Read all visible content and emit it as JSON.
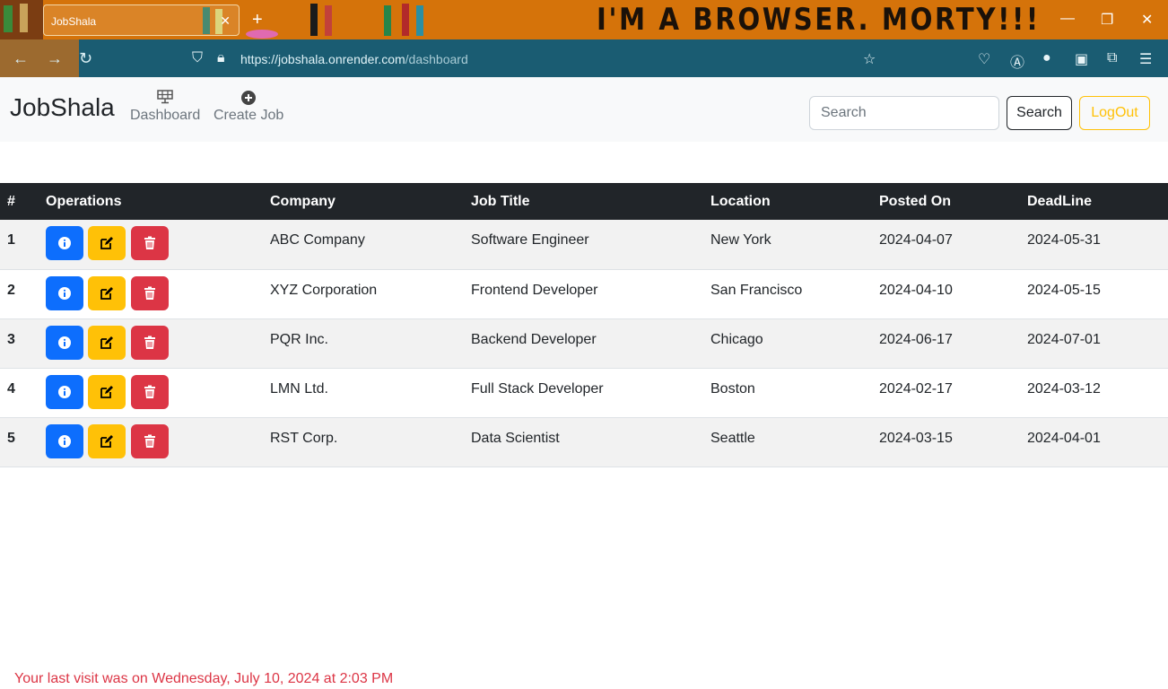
{
  "browser": {
    "tab_title": "JobShala",
    "theme_banner": "I'M A BROWSER. MORTY!!!",
    "url_host": "https://jobshala.onrender.com",
    "url_path": "/dashboard"
  },
  "navbar": {
    "brand": "JobShala",
    "links": [
      {
        "label": "Dashboard",
        "icon": "dashboard-grid-icon"
      },
      {
        "label": "Create Job",
        "icon": "plus-circle-icon"
      }
    ],
    "search_placeholder": "Search",
    "search_label": "Search",
    "logout_label": "LogOut"
  },
  "table": {
    "headers": [
      "#",
      "Operations",
      "Company",
      "Job Title",
      "Location",
      "Posted On",
      "DeadLine"
    ],
    "rows": [
      {
        "idx": "1",
        "company": "ABC Company",
        "title": "Software Engineer",
        "location": "New York",
        "posted": "2024-04-07",
        "deadline": "2024-05-31"
      },
      {
        "idx": "2",
        "company": "XYZ Corporation",
        "title": "Frontend Developer",
        "location": "San Francisco",
        "posted": "2024-04-10",
        "deadline": "2024-05-15"
      },
      {
        "idx": "3",
        "company": "PQR Inc.",
        "title": "Backend Developer",
        "location": "Chicago",
        "posted": "2024-06-17",
        "deadline": "2024-07-01"
      },
      {
        "idx": "4",
        "company": "LMN Ltd.",
        "title": "Full Stack Developer",
        "location": "Boston",
        "posted": "2024-02-17",
        "deadline": "2024-03-12"
      },
      {
        "idx": "5",
        "company": "RST Corp.",
        "title": "Data Scientist",
        "location": "Seattle",
        "posted": "2024-03-15",
        "deadline": "2024-04-01"
      }
    ]
  },
  "footer": {
    "last_visit": "Your last visit was on Wednesday, July 10, 2024 at 2:03 PM"
  },
  "colors": {
    "info": "#0d6efd",
    "warning": "#ffc107",
    "danger": "#dc3545",
    "table_header": "#212529"
  }
}
